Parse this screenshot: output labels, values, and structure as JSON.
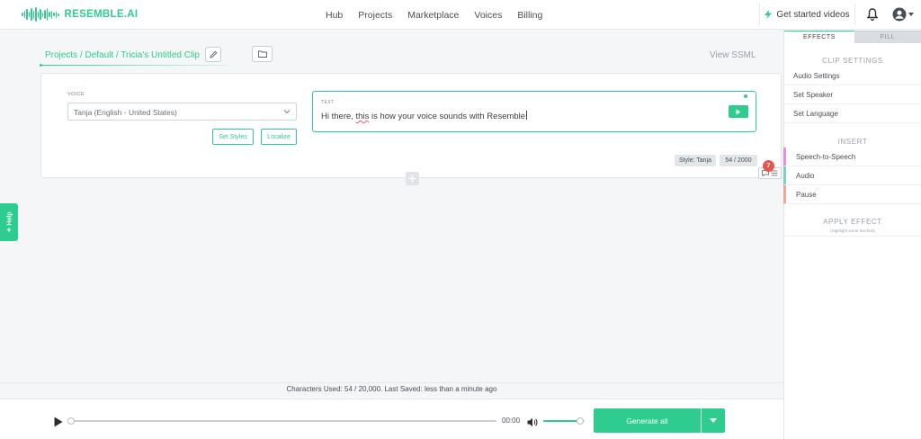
{
  "brand": {
    "name": "RESEMBLE.AI"
  },
  "nav": {
    "items": [
      "Hub",
      "Projects",
      "Marketplace",
      "Voices",
      "Billing"
    ]
  },
  "header": {
    "get_started": "Get started videos"
  },
  "breadcrumb": {
    "text": "Projects / Default / Tricia's Untitled Clip"
  },
  "editor": {
    "view_ssml": "View SSML",
    "voice_label": "VOICE",
    "voice_value": "Tanja (English - United States)",
    "set_styles": "Set Styles",
    "localize": "Localize",
    "text_label": "TEXT",
    "text_before": "Hi there, ",
    "text_flagged": "this",
    "text_after": " is how your voice sounds with Resemble",
    "style_tag": "Style: Tanja",
    "char_tag": "54 / 2000",
    "badge_count": "7"
  },
  "help": {
    "label": "Help"
  },
  "panel": {
    "tabs": [
      "EFFECTS",
      "FILL"
    ],
    "clip_settings_title": "CLIP SETTINGS",
    "clip_settings": [
      "Audio Settings",
      "Set Speaker",
      "Set Language"
    ],
    "insert_title": "INSERT",
    "insert_items": [
      {
        "label": "Speech-to-Speech",
        "color": "#e98be0"
      },
      {
        "label": "Audio",
        "color": "#7fd1bb"
      },
      {
        "label": "Pause",
        "color": "#f4a49a"
      }
    ],
    "apply_title": "APPLY EFFECT",
    "apply_note": "(Highlight some text first)"
  },
  "status": {
    "text": "Characters Used: 54 / 20,000. Last Saved: less than a minute ago"
  },
  "player": {
    "time": "00:00",
    "volume": 0.9,
    "progress": 0.0,
    "generate": "Generate all"
  },
  "colors": {
    "accent": "#2ecc8f",
    "badge": "#e4574f"
  }
}
